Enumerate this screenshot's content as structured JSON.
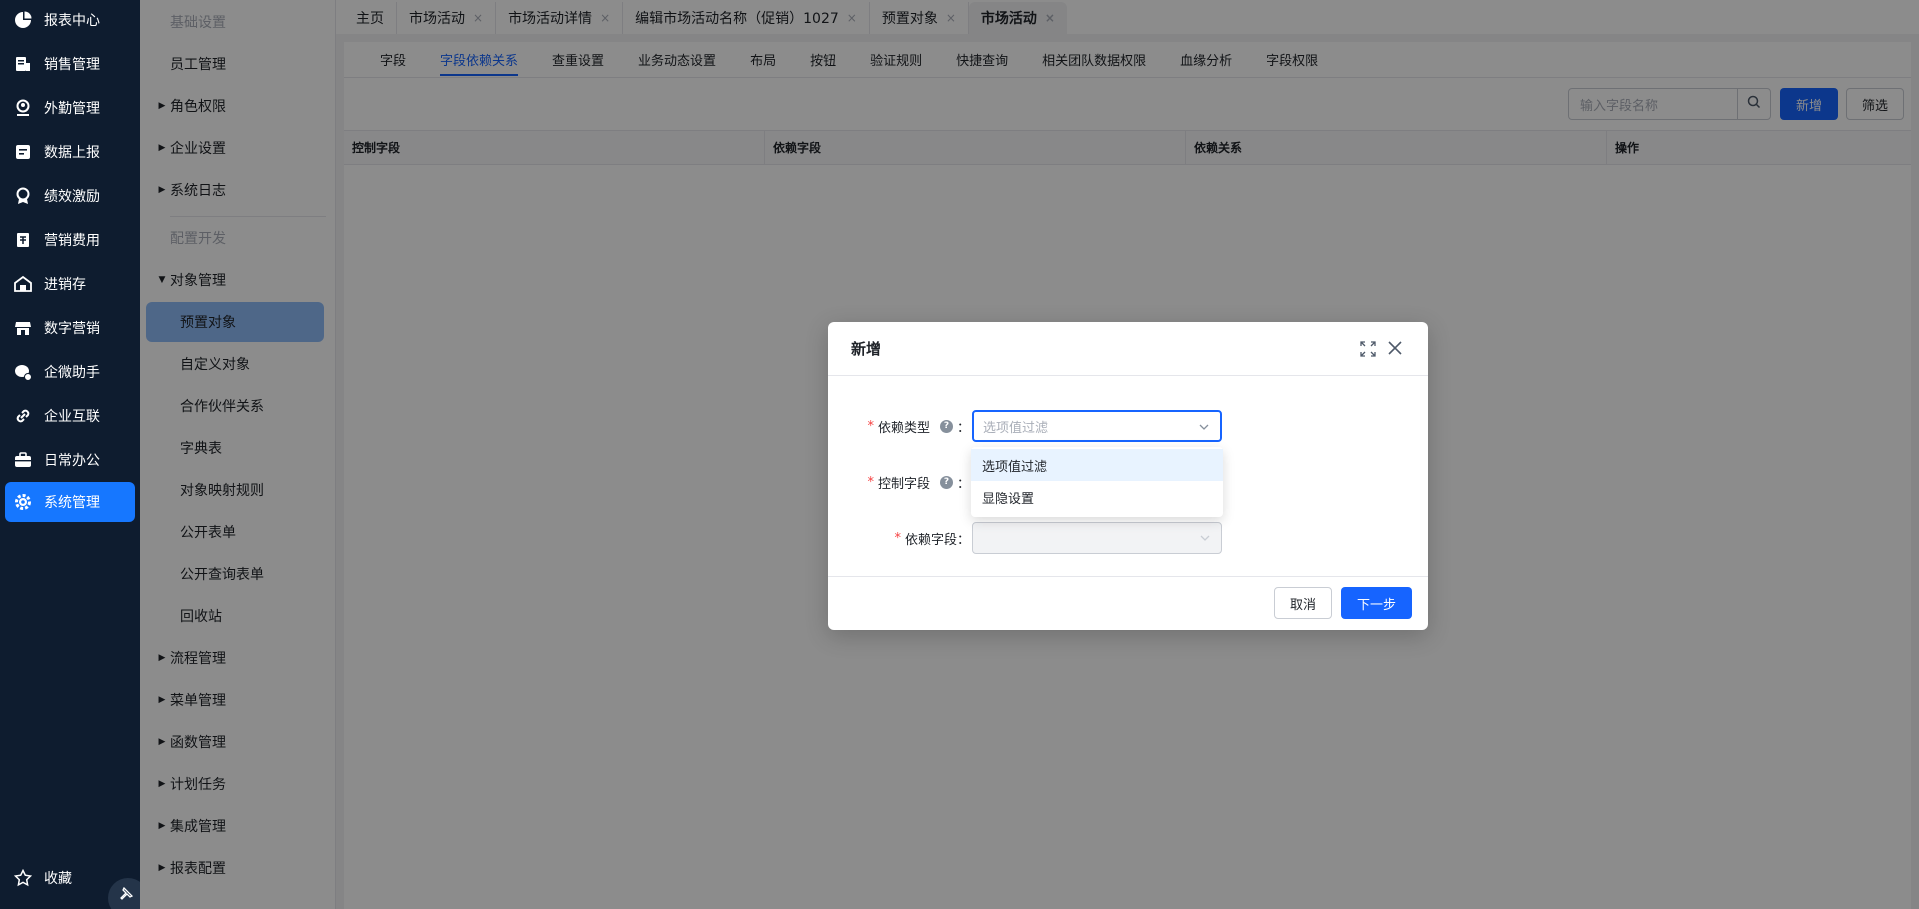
{
  "leftnav": {
    "items": [
      {
        "label": "报表中心",
        "icon": "pie-chart-icon"
      },
      {
        "label": "销售管理",
        "icon": "sales-icon"
      },
      {
        "label": "外勤管理",
        "icon": "location-person-icon"
      },
      {
        "label": "数据上报",
        "icon": "report-upload-icon"
      },
      {
        "label": "绩效激励",
        "icon": "medal-icon"
      },
      {
        "label": "营销费用",
        "icon": "expense-icon"
      },
      {
        "label": "进销存",
        "icon": "warehouse-icon"
      },
      {
        "label": "数字营销",
        "icon": "store-icon"
      },
      {
        "label": "企微助手",
        "icon": "wecom-icon"
      },
      {
        "label": "企业互联",
        "icon": "link-icon"
      },
      {
        "label": "日常办公",
        "icon": "briefcase-icon"
      },
      {
        "label": "系统管理",
        "icon": "gear-icon"
      }
    ],
    "active_index": 11,
    "favorites_label": "收藏"
  },
  "submenu": {
    "group1": "基础设置",
    "employee": "员工管理",
    "role": "角色权限",
    "enterprise": "企业设置",
    "syslog": "系统日志",
    "group2": "配置开发",
    "object_mgmt": "对象管理",
    "preset_object": "预置对象",
    "custom_object": "自定义对象",
    "partner": "合作伙伴关系",
    "dict": "字典表",
    "mapping": "对象映射规则",
    "public_form": "公开表单",
    "public_query": "公开查询表单",
    "recycle": "回收站",
    "process": "流程管理",
    "menu": "菜单管理",
    "function": "函数管理",
    "schedule": "计划任务",
    "integration": "集成管理",
    "report_cfg": "报表配置"
  },
  "toptabs": {
    "home": "主页",
    "t1": "市场活动",
    "t2": "市场活动详情",
    "t3": "编辑市场活动名称（促销）1027",
    "t4": "预置对象",
    "t5": "市场活动",
    "close": "×"
  },
  "subtabs": {
    "field": "字段",
    "dependency": "字段依赖关系",
    "dedupe": "查重设置",
    "dynamic": "业务动态设置",
    "layout": "布局",
    "button": "按钮",
    "validation": "验证规则",
    "quick_query": "快捷查询",
    "team_perm": "相关团队数据权限",
    "lineage": "血缘分析",
    "field_perm": "字段权限"
  },
  "toolbar": {
    "search_placeholder": "输入字段名称",
    "add": "新增",
    "filter": "筛选"
  },
  "table": {
    "headers": [
      "控制字段",
      "依赖字段",
      "依赖关系",
      "操作"
    ]
  },
  "dialog": {
    "title": "新增",
    "dep_type_label": "依赖类型",
    "dep_type_placeholder": "选项值过滤",
    "control_label": "控制字段",
    "depend_label": "依赖字段",
    "required_mark": "*",
    "help": "?",
    "colon": "：",
    "options": [
      "选项值过滤",
      "显隐设置"
    ],
    "cancel": "取消",
    "next": "下一步"
  },
  "colors": {
    "nav_bg": "#0e1c2f",
    "accent": "#1664ff",
    "selected_menu": "#8fbcf8"
  }
}
